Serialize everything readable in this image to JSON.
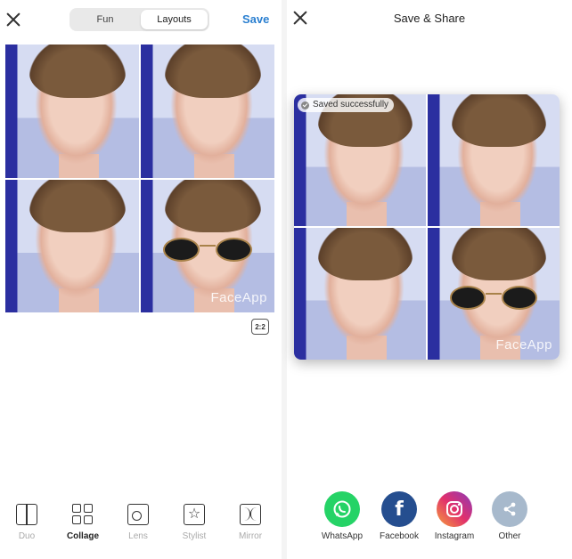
{
  "left": {
    "segment": {
      "options": [
        "Fun",
        "Layouts"
      ],
      "selected": "Layouts"
    },
    "save_label": "Save",
    "watermark": "FaceApp",
    "ratio_label": "2:2",
    "tools": [
      {
        "label": "Duo",
        "icon": "duo-icon",
        "active": false
      },
      {
        "label": "Collage",
        "icon": "collage-icon",
        "active": true
      },
      {
        "label": "Lens",
        "icon": "lens-icon",
        "active": false
      },
      {
        "label": "Stylist",
        "icon": "star-icon",
        "active": false
      },
      {
        "label": "Mirror",
        "icon": "mirror-icon",
        "active": false
      }
    ]
  },
  "right": {
    "title": "Save & Share",
    "saved_text": "Saved successfully",
    "watermark": "FaceApp",
    "share": [
      {
        "label": "WhatsApp",
        "icon": "whatsapp-icon",
        "color": "#25d366"
      },
      {
        "label": "Facebook",
        "icon": "facebook-icon",
        "color": "#254e8f"
      },
      {
        "label": "Instagram",
        "icon": "instagram-icon",
        "color": "#d6336c"
      },
      {
        "label": "Other",
        "icon": "share-icon",
        "color": "#a7b9cc"
      }
    ]
  }
}
